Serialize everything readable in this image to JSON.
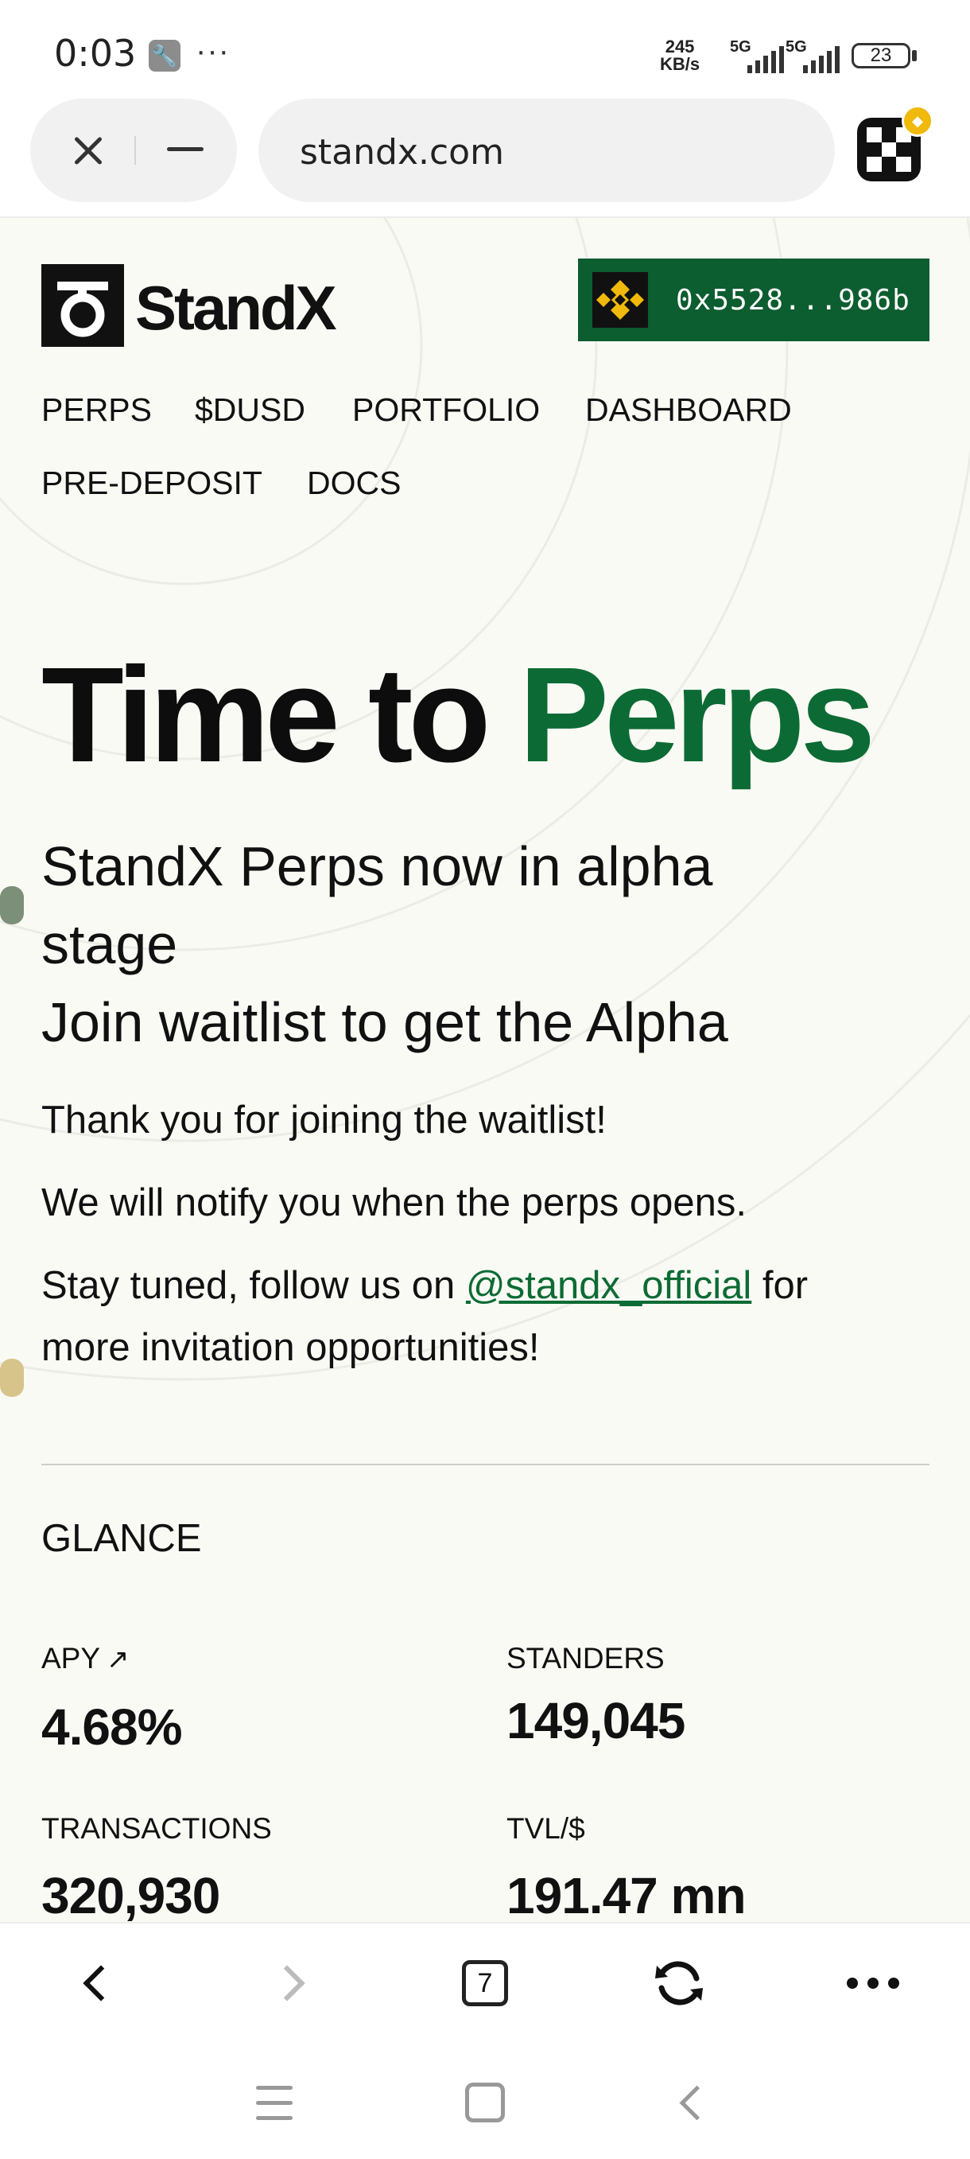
{
  "status_bar": {
    "time": "0:03",
    "dots": "···",
    "net_speed_value": "245",
    "net_speed_unit": "KB/s",
    "signal_1": "5G",
    "signal_2": "5G",
    "battery": "23",
    "icons": [
      "wrench-icon",
      "signal-icon",
      "battery-icon"
    ]
  },
  "browser": {
    "url": "standx.com",
    "icons": [
      "close-icon",
      "minimize-icon",
      "wallet-app-icon"
    ]
  },
  "header": {
    "logo_text": "StandX",
    "wallet_address": "0x5528...986b",
    "wallet_button_color": "#0c5d2f",
    "bnb_color": "#f0b90b"
  },
  "nav": {
    "items": [
      "PERPS",
      "$DUSD",
      "PORTFOLIO",
      "DASHBOARD",
      "PRE-DEPOSIT",
      "DOCS"
    ]
  },
  "hero": {
    "title_main": "Time to ",
    "title_accent": "Perps",
    "accent_color": "#0c6b34",
    "subtitle_line1": "StandX Perps now in alpha",
    "subtitle_line2": "stage",
    "subtitle_line3": "Join waitlist to get the Alpha",
    "thanks": "Thank you for joining the waitlist!",
    "notify": "We will notify you when the perps opens.",
    "stay_tuned_prefix": "Stay tuned, follow us on ",
    "twitter_handle": "@standx_official",
    "stay_tuned_suffix": " for",
    "stay_tuned_line2": "more invitation opportunities!"
  },
  "glance": {
    "heading": "GLANCE",
    "apy_label": "APY",
    "apy_value": "4.68%",
    "standers_label": "STANDERS",
    "standers_value": "149,045",
    "transactions_label": "TRANSACTIONS",
    "transactions_value": "320,930",
    "tvl_label": "TVL/$",
    "tvl_value": "191.47 mn"
  },
  "bottom_bar": {
    "tab_count": "7",
    "icons": [
      "back-icon",
      "forward-icon",
      "tabs-icon",
      "refresh-icon",
      "more-icon"
    ]
  }
}
